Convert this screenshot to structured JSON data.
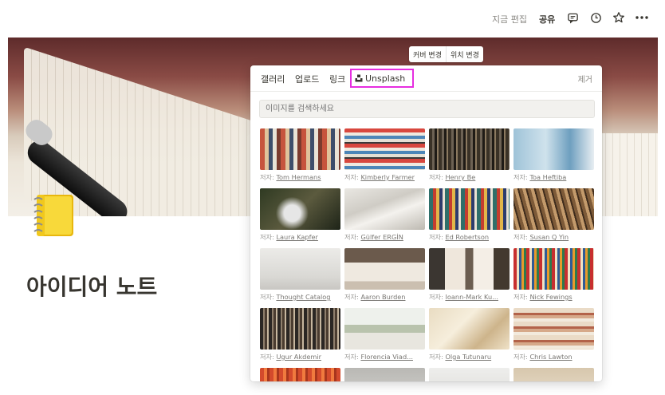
{
  "topbar": {
    "edit_label": "지금 편집",
    "share_label": "공유",
    "icons": [
      "comment-icon",
      "history-icon",
      "star-icon",
      "more-icon"
    ]
  },
  "cover_buttons": {
    "change": "커버 변경",
    "reposition": "위치 변경"
  },
  "page": {
    "title": "아이디어 노트",
    "icon": "notebook-icon"
  },
  "modal": {
    "tabs": [
      "갤러리",
      "업로드",
      "링크",
      "Unsplash"
    ],
    "remove": "제거",
    "search": {
      "placeholder": "이미지를 검색하세요"
    },
    "prefix": "저자:",
    "images": [
      {
        "author": "Tom Hermans"
      },
      {
        "author": "Kimberly Farmer"
      },
      {
        "author": "Henry Be"
      },
      {
        "author": "Toa Heftiba"
      },
      {
        "author": "Laura Kapfer"
      },
      {
        "author": "Gülfer ERGİN"
      },
      {
        "author": "Ed Robertson"
      },
      {
        "author": "Susan Q Yin"
      },
      {
        "author": "Thought Catalog"
      },
      {
        "author": "Aaron Burden"
      },
      {
        "author": "Ioann-Mark Ku..."
      },
      {
        "author": "Nick Fewings"
      },
      {
        "author": "Ugur Akdemir"
      },
      {
        "author": "Florencia Viad..."
      },
      {
        "author": "Olga Tutunaru"
      },
      {
        "author": "Chris Lawton"
      }
    ]
  }
}
